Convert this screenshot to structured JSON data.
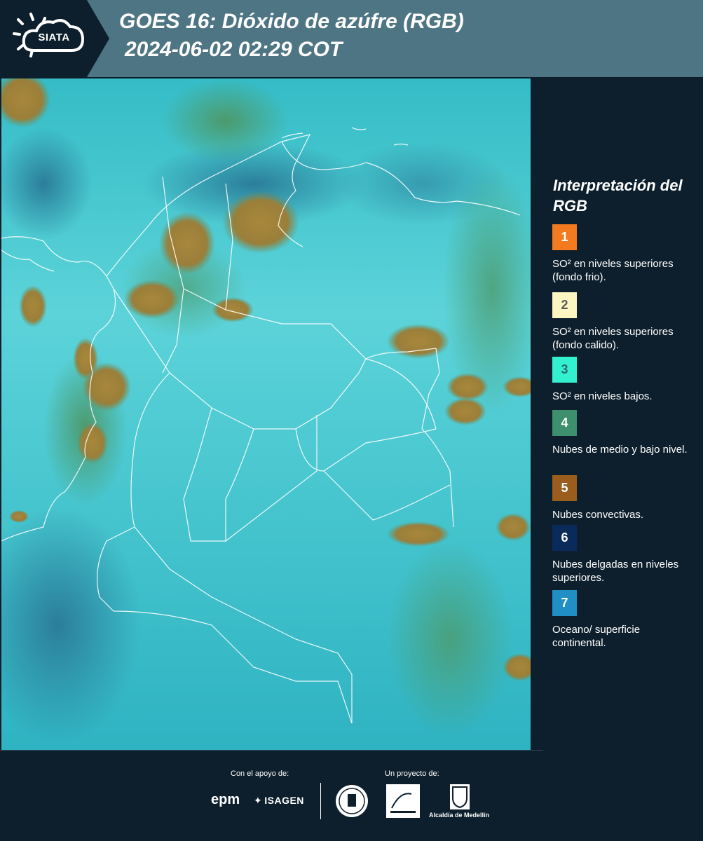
{
  "header": {
    "logo_text": "SIATA",
    "title_line1": "GOES 16: Dióxido de azúfre (RGB)",
    "title_line2": "2024-06-02 02:29 COT"
  },
  "map": {
    "description_icon": "satellite-map-image"
  },
  "legend": {
    "title": "Interpretación del RGB",
    "items": [
      {
        "number": "1",
        "color": "#f47a1f",
        "text_color": "#ffffff",
        "desc": "SO² en niveles superiores (fondo frio)."
      },
      {
        "number": "2",
        "color": "#fdf6c3",
        "text_color": "#5a5a5a",
        "desc": "SO² en niveles superiores (fondo calido)."
      },
      {
        "number": "3",
        "color": "#33f1cf",
        "text_color": "#2b6b6b",
        "desc": "SO² en niveles bajos."
      },
      {
        "number": "4",
        "color": "#3d8f6d",
        "text_color": "#ffffff",
        "desc": "Nubes de medio y bajo nivel."
      },
      {
        "number": "5",
        "color": "#9a5d1e",
        "text_color": "#ffffff",
        "desc": "Nubes convectivas."
      },
      {
        "number": "6",
        "color": "#0b2a5c",
        "text_color": "#ffffff",
        "desc": "Nubes delgadas en niveles superiores."
      },
      {
        "number": "7",
        "color": "#1f8fc4",
        "text_color": "#ffffff",
        "desc": "Oceano/ superficie continental."
      }
    ]
  },
  "footer": {
    "support_label": "Con el apoyo de:",
    "project_label": "Un proyecto de:",
    "epm": "epm",
    "isagen": "ISAGEN",
    "alcaldia": "Alcaldía de Medellín"
  }
}
